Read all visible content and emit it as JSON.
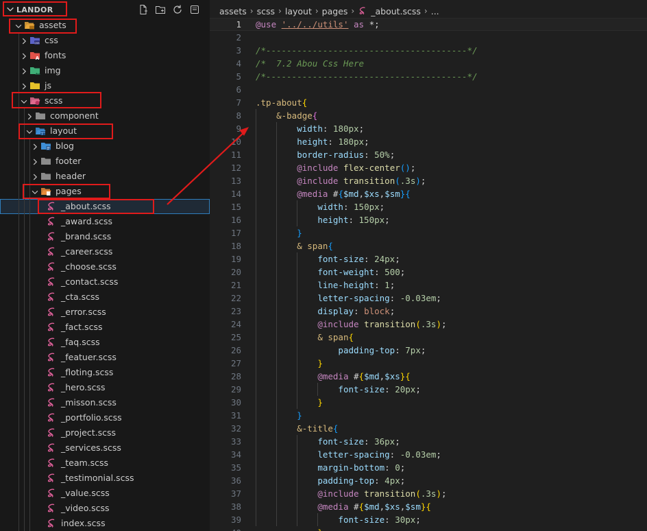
{
  "explorer": {
    "title": "LANDOR",
    "tree": [
      {
        "label": "assets",
        "depth": 0,
        "kind": "folder-open",
        "icon": "folder-assets-icon",
        "expanded": true
      },
      {
        "label": "css",
        "depth": 1,
        "kind": "folder",
        "icon": "folder-css-icon",
        "expanded": false
      },
      {
        "label": "fonts",
        "depth": 1,
        "kind": "folder",
        "icon": "folder-fonts-icon",
        "expanded": false
      },
      {
        "label": "img",
        "depth": 1,
        "kind": "folder",
        "icon": "folder-img-icon",
        "expanded": false
      },
      {
        "label": "js",
        "depth": 1,
        "kind": "folder",
        "icon": "folder-js-icon",
        "expanded": false
      },
      {
        "label": "scss",
        "depth": 1,
        "kind": "folder-open",
        "icon": "folder-scss-icon",
        "expanded": true
      },
      {
        "label": "component",
        "depth": 2,
        "kind": "folder",
        "icon": "folder-icon",
        "expanded": false
      },
      {
        "label": "layout",
        "depth": 2,
        "kind": "folder-open",
        "icon": "folder-layout-icon",
        "expanded": true
      },
      {
        "label": "blog",
        "depth": 3,
        "kind": "folder",
        "icon": "folder-blog-icon",
        "expanded": false
      },
      {
        "label": "footer",
        "depth": 3,
        "kind": "folder",
        "icon": "folder-icon",
        "expanded": false
      },
      {
        "label": "header",
        "depth": 3,
        "kind": "folder",
        "icon": "folder-icon",
        "expanded": false
      },
      {
        "label": "pages",
        "depth": 3,
        "kind": "folder-open",
        "icon": "folder-pages-icon",
        "expanded": true
      },
      {
        "label": "_about.scss",
        "depth": 4,
        "kind": "file",
        "icon": "sass-icon",
        "selected": true
      },
      {
        "label": "_award.scss",
        "depth": 4,
        "kind": "file",
        "icon": "sass-icon"
      },
      {
        "label": "_brand.scss",
        "depth": 4,
        "kind": "file",
        "icon": "sass-icon"
      },
      {
        "label": "_career.scss",
        "depth": 4,
        "kind": "file",
        "icon": "sass-icon"
      },
      {
        "label": "_choose.scss",
        "depth": 4,
        "kind": "file",
        "icon": "sass-icon"
      },
      {
        "label": "_contact.scss",
        "depth": 4,
        "kind": "file",
        "icon": "sass-icon"
      },
      {
        "label": "_cta.scss",
        "depth": 4,
        "kind": "file",
        "icon": "sass-icon"
      },
      {
        "label": "_error.scss",
        "depth": 4,
        "kind": "file",
        "icon": "sass-icon"
      },
      {
        "label": "_fact.scss",
        "depth": 4,
        "kind": "file",
        "icon": "sass-icon"
      },
      {
        "label": "_faq.scss",
        "depth": 4,
        "kind": "file",
        "icon": "sass-icon"
      },
      {
        "label": "_featuer.scss",
        "depth": 4,
        "kind": "file",
        "icon": "sass-icon"
      },
      {
        "label": "_floting.scss",
        "depth": 4,
        "kind": "file",
        "icon": "sass-icon"
      },
      {
        "label": "_hero.scss",
        "depth": 4,
        "kind": "file",
        "icon": "sass-icon"
      },
      {
        "label": "_misson.scss",
        "depth": 4,
        "kind": "file",
        "icon": "sass-icon"
      },
      {
        "label": "_portfolio.scss",
        "depth": 4,
        "kind": "file",
        "icon": "sass-icon"
      },
      {
        "label": "_project.scss",
        "depth": 4,
        "kind": "file",
        "icon": "sass-icon"
      },
      {
        "label": "_services.scss",
        "depth": 4,
        "kind": "file",
        "icon": "sass-icon"
      },
      {
        "label": "_team.scss",
        "depth": 4,
        "kind": "file",
        "icon": "sass-icon"
      },
      {
        "label": "_testimonial.scss",
        "depth": 4,
        "kind": "file",
        "icon": "sass-icon"
      },
      {
        "label": "_value.scss",
        "depth": 4,
        "kind": "file",
        "icon": "sass-icon"
      },
      {
        "label": "_video.scss",
        "depth": 4,
        "kind": "file",
        "icon": "sass-icon"
      },
      {
        "label": "index.scss",
        "depth": 4,
        "kind": "file",
        "icon": "sass-icon"
      }
    ],
    "actions": [
      "new-file-icon",
      "new-folder-icon",
      "refresh-icon",
      "collapse-all-icon"
    ]
  },
  "breadcrumb": [
    "assets",
    "scss",
    "layout",
    "pages",
    "_about.scss",
    "..."
  ],
  "editor": {
    "active_line": 1,
    "lines": [
      [
        [
          "t-kw",
          "@use"
        ],
        [
          "t-plain",
          " "
        ],
        [
          "t-str-u",
          "'../../utils'"
        ],
        [
          "t-plain",
          " "
        ],
        [
          "t-kw",
          "as"
        ],
        [
          "t-plain",
          " *;"
        ]
      ],
      [],
      [
        [
          "t-com",
          "/*---------------------------------------*/"
        ]
      ],
      [
        [
          "t-com",
          "/*  7.2 Abou Css Here"
        ]
      ],
      [
        [
          "t-com",
          "/*---------------------------------------*/"
        ]
      ],
      [],
      [
        [
          "t-sel",
          ".tp-about"
        ],
        [
          "t-b1",
          "{"
        ]
      ],
      [
        [
          "t-plain",
          "    "
        ],
        [
          "t-sel",
          "&-badge"
        ],
        [
          "t-b2",
          "{"
        ]
      ],
      [
        [
          "t-plain",
          "        "
        ],
        [
          "t-prop",
          "width"
        ],
        [
          "t-plain",
          ": "
        ],
        [
          "t-num",
          "180px"
        ],
        [
          "t-plain",
          ";"
        ]
      ],
      [
        [
          "t-plain",
          "        "
        ],
        [
          "t-prop",
          "height"
        ],
        [
          "t-plain",
          ": "
        ],
        [
          "t-num",
          "180px"
        ],
        [
          "t-plain",
          ";"
        ]
      ],
      [
        [
          "t-plain",
          "        "
        ],
        [
          "t-prop",
          "border-radius"
        ],
        [
          "t-plain",
          ": "
        ],
        [
          "t-num",
          "50%"
        ],
        [
          "t-plain",
          ";"
        ]
      ],
      [
        [
          "t-plain",
          "        "
        ],
        [
          "t-kw",
          "@include"
        ],
        [
          "t-plain",
          " "
        ],
        [
          "t-fn",
          "flex-center"
        ],
        [
          "t-b3",
          "()"
        ],
        [
          "t-plain",
          ";"
        ]
      ],
      [
        [
          "t-plain",
          "        "
        ],
        [
          "t-kw",
          "@include"
        ],
        [
          "t-plain",
          " "
        ],
        [
          "t-fn",
          "transition"
        ],
        [
          "t-b3",
          "("
        ],
        [
          "t-num",
          ".3s"
        ],
        [
          "t-b3",
          ")"
        ],
        [
          "t-plain",
          ";"
        ]
      ],
      [
        [
          "t-plain",
          "        "
        ],
        [
          "t-kw",
          "@media"
        ],
        [
          "t-plain",
          " #"
        ],
        [
          "t-b3",
          "{"
        ],
        [
          "t-var",
          "$md"
        ],
        [
          "t-plain",
          ","
        ],
        [
          "t-var",
          "$xs"
        ],
        [
          "t-plain",
          ","
        ],
        [
          "t-var",
          "$sm"
        ],
        [
          "t-b3",
          "}"
        ],
        [
          "t-b3",
          "{"
        ]
      ],
      [
        [
          "t-plain",
          "            "
        ],
        [
          "t-prop",
          "width"
        ],
        [
          "t-plain",
          ": "
        ],
        [
          "t-num",
          "150px"
        ],
        [
          "t-plain",
          ";"
        ]
      ],
      [
        [
          "t-plain",
          "            "
        ],
        [
          "t-prop",
          "height"
        ],
        [
          "t-plain",
          ": "
        ],
        [
          "t-num",
          "150px"
        ],
        [
          "t-plain",
          ";"
        ]
      ],
      [
        [
          "t-plain",
          "        "
        ],
        [
          "t-b3",
          "}"
        ]
      ],
      [
        [
          "t-plain",
          "        "
        ],
        [
          "t-sel",
          "& span"
        ],
        [
          "t-b3",
          "{"
        ]
      ],
      [
        [
          "t-plain",
          "            "
        ],
        [
          "t-prop",
          "font-size"
        ],
        [
          "t-plain",
          ": "
        ],
        [
          "t-num",
          "24px"
        ],
        [
          "t-plain",
          ";"
        ]
      ],
      [
        [
          "t-plain",
          "            "
        ],
        [
          "t-prop",
          "font-weight"
        ],
        [
          "t-plain",
          ": "
        ],
        [
          "t-num",
          "500"
        ],
        [
          "t-plain",
          ";"
        ]
      ],
      [
        [
          "t-plain",
          "            "
        ],
        [
          "t-prop",
          "line-height"
        ],
        [
          "t-plain",
          ": "
        ],
        [
          "t-num",
          "1"
        ],
        [
          "t-plain",
          ";"
        ]
      ],
      [
        [
          "t-plain",
          "            "
        ],
        [
          "t-prop",
          "letter-spacing"
        ],
        [
          "t-plain",
          ": "
        ],
        [
          "t-num",
          "-0.03em"
        ],
        [
          "t-plain",
          ";"
        ]
      ],
      [
        [
          "t-plain",
          "            "
        ],
        [
          "t-prop",
          "display"
        ],
        [
          "t-plain",
          ": "
        ],
        [
          "t-val",
          "block"
        ],
        [
          "t-plain",
          ";"
        ]
      ],
      [
        [
          "t-plain",
          "            "
        ],
        [
          "t-kw",
          "@include"
        ],
        [
          "t-plain",
          " "
        ],
        [
          "t-fn",
          "transition"
        ],
        [
          "t-b1",
          "("
        ],
        [
          "t-num",
          ".3s"
        ],
        [
          "t-b1",
          ")"
        ],
        [
          "t-plain",
          ";"
        ]
      ],
      [
        [
          "t-plain",
          "            "
        ],
        [
          "t-sel",
          "& span"
        ],
        [
          "t-b1",
          "{"
        ]
      ],
      [
        [
          "t-plain",
          "                "
        ],
        [
          "t-prop",
          "padding-top"
        ],
        [
          "t-plain",
          ": "
        ],
        [
          "t-num",
          "7px"
        ],
        [
          "t-plain",
          ";"
        ]
      ],
      [
        [
          "t-plain",
          "            "
        ],
        [
          "t-b1",
          "}"
        ]
      ],
      [
        [
          "t-plain",
          "            "
        ],
        [
          "t-kw",
          "@media"
        ],
        [
          "t-plain",
          " #"
        ],
        [
          "t-b1",
          "{"
        ],
        [
          "t-var",
          "$md"
        ],
        [
          "t-plain",
          ","
        ],
        [
          "t-var",
          "$xs"
        ],
        [
          "t-b1",
          "}"
        ],
        [
          "t-b1",
          "{"
        ]
      ],
      [
        [
          "t-plain",
          "                "
        ],
        [
          "t-prop",
          "font-size"
        ],
        [
          "t-plain",
          ": "
        ],
        [
          "t-num",
          "20px"
        ],
        [
          "t-plain",
          ";"
        ]
      ],
      [
        [
          "t-plain",
          "            "
        ],
        [
          "t-b1",
          "}"
        ]
      ],
      [
        [
          "t-plain",
          "        "
        ],
        [
          "t-b3",
          "}"
        ]
      ],
      [
        [
          "t-plain",
          "        "
        ],
        [
          "t-sel",
          "&-title"
        ],
        [
          "t-b3",
          "{"
        ]
      ],
      [
        [
          "t-plain",
          "            "
        ],
        [
          "t-prop",
          "font-size"
        ],
        [
          "t-plain",
          ": "
        ],
        [
          "t-num",
          "36px"
        ],
        [
          "t-plain",
          ";"
        ]
      ],
      [
        [
          "t-plain",
          "            "
        ],
        [
          "t-prop",
          "letter-spacing"
        ],
        [
          "t-plain",
          ": "
        ],
        [
          "t-num",
          "-0.03em"
        ],
        [
          "t-plain",
          ";"
        ]
      ],
      [
        [
          "t-plain",
          "            "
        ],
        [
          "t-prop",
          "margin-bottom"
        ],
        [
          "t-plain",
          ": "
        ],
        [
          "t-num",
          "0"
        ],
        [
          "t-plain",
          ";"
        ]
      ],
      [
        [
          "t-plain",
          "            "
        ],
        [
          "t-prop",
          "padding-top"
        ],
        [
          "t-plain",
          ": "
        ],
        [
          "t-num",
          "4px"
        ],
        [
          "t-plain",
          ";"
        ]
      ],
      [
        [
          "t-plain",
          "            "
        ],
        [
          "t-kw",
          "@include"
        ],
        [
          "t-plain",
          " "
        ],
        [
          "t-fn",
          "transition"
        ],
        [
          "t-b1",
          "("
        ],
        [
          "t-num",
          ".3s"
        ],
        [
          "t-b1",
          ")"
        ],
        [
          "t-plain",
          ";"
        ]
      ],
      [
        [
          "t-plain",
          "            "
        ],
        [
          "t-kw",
          "@media"
        ],
        [
          "t-plain",
          " #"
        ],
        [
          "t-b1",
          "{"
        ],
        [
          "t-var",
          "$md"
        ],
        [
          "t-plain",
          ","
        ],
        [
          "t-var",
          "$xs"
        ],
        [
          "t-plain",
          ","
        ],
        [
          "t-var",
          "$sm"
        ],
        [
          "t-b1",
          "}"
        ],
        [
          "t-b1",
          "{"
        ]
      ],
      [
        [
          "t-plain",
          "                "
        ],
        [
          "t-prop",
          "font-size"
        ],
        [
          "t-plain",
          ": "
        ],
        [
          "t-num",
          "30px"
        ],
        [
          "t-plain",
          ";"
        ]
      ],
      [
        [
          "t-plain",
          "            "
        ],
        [
          "t-b1",
          "}"
        ]
      ]
    ]
  },
  "annotation": {
    "highlight_color": "#e01b1b"
  }
}
